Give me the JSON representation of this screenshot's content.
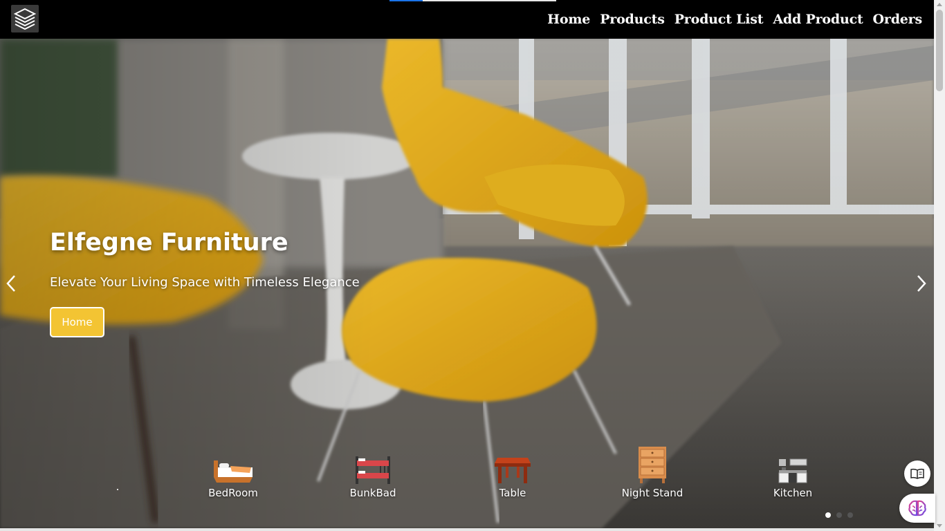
{
  "header": {
    "logo_icon": "stacked-layers-logo-icon",
    "nav": [
      {
        "label": "Home"
      },
      {
        "label": "Products"
      },
      {
        "label": "Product List"
      },
      {
        "label": "Add Product"
      },
      {
        "label": "Orders"
      }
    ],
    "loading_progress": 0.2
  },
  "hero": {
    "title": "Elfegne Furniture",
    "subtitle": "Elevate Your Living Space with Timeless Elegance",
    "button_label": "Home",
    "prev_icon": "chevron-left-icon",
    "next_icon": "chevron-right-icon",
    "accent_color": "#f3c433"
  },
  "categories": [
    {
      "label": "BedRoom",
      "icon": "bed-icon"
    },
    {
      "label": "BunkBad",
      "icon": "bunk-bed-icon"
    },
    {
      "label": "Table",
      "icon": "table-icon"
    },
    {
      "label": "Night Stand",
      "icon": "night-stand-icon"
    },
    {
      "label": "Kitchen",
      "icon": "kitchen-icon"
    }
  ],
  "carousel": {
    "slides": 3,
    "active_slide": 1
  },
  "widgets": {
    "reader_icon": "open-book-icon",
    "assistant_icon": "brain-icon"
  }
}
